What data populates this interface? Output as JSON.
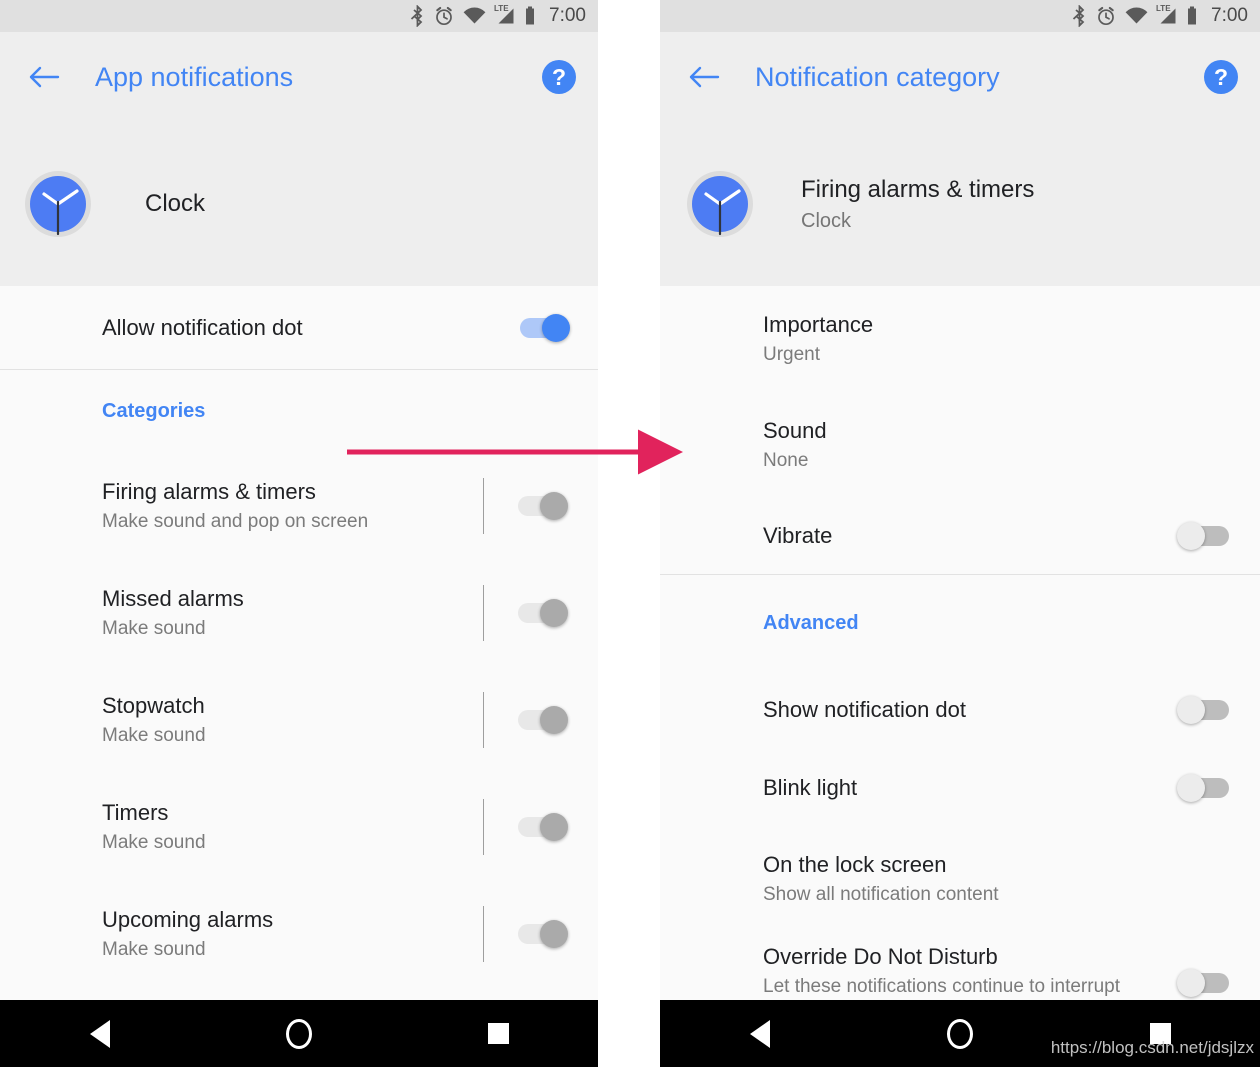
{
  "colors": {
    "accent_blue": "#4285f4",
    "arrow_pink": "#e1235c",
    "header_bg": "#eeeeee",
    "content_bg": "#fafafa",
    "statusbar_bg": "#e0e0e0",
    "toggle_on_grey": "#aaaaaa",
    "toggle_on_blue": "#4285f4",
    "toggle_off": "#ececec",
    "navbar_bg": "#000000"
  },
  "status_bar": {
    "time": "7:00",
    "icons": [
      "bluetooth-icon",
      "alarm-icon",
      "wifi-icon",
      "lte-signal-icon",
      "battery-icon"
    ],
    "lte_label": "LTE"
  },
  "left_panel": {
    "appbar": {
      "back_label": "←",
      "title": "App notifications",
      "help_label": "?"
    },
    "app_header": {
      "icon": "clock-app-icon",
      "name": "Clock"
    },
    "allow_dot": {
      "label": "Allow notification dot",
      "toggle_state": "on"
    },
    "section_label": "Categories",
    "categories": [
      {
        "title": "Firing alarms & timers",
        "subtitle": "Make sound and pop on screen",
        "toggle_state": "on"
      },
      {
        "title": "Missed alarms",
        "subtitle": "Make sound",
        "toggle_state": "on"
      },
      {
        "title": "Stopwatch",
        "subtitle": "Make sound",
        "toggle_state": "on"
      },
      {
        "title": "Timers",
        "subtitle": "Make sound",
        "toggle_state": "on"
      },
      {
        "title": "Upcoming alarms",
        "subtitle": "Make sound",
        "toggle_state": "on"
      }
    ]
  },
  "right_panel": {
    "appbar": {
      "back_label": "←",
      "title": "Notification category",
      "help_label": "?"
    },
    "app_header": {
      "icon": "clock-app-icon",
      "title": "Firing alarms & timers",
      "subtitle": "Clock"
    },
    "settings": [
      {
        "title": "Importance",
        "subtitle": "Urgent"
      },
      {
        "title": "Sound",
        "subtitle": "None"
      },
      {
        "title": "Vibrate",
        "subtitle": "",
        "toggle_state": "off"
      }
    ],
    "advanced_label": "Advanced",
    "advanced": [
      {
        "title": "Show notification dot",
        "subtitle": "",
        "toggle_state": "off"
      },
      {
        "title": "Blink light",
        "subtitle": "",
        "toggle_state": "off"
      },
      {
        "title": "On the lock screen",
        "subtitle": "Show all notification content"
      },
      {
        "title": "Override Do Not Disturb",
        "subtitle": "Let these notifications continue to interrupt when Do Not Disturb is set to",
        "toggle_state": "off"
      }
    ]
  },
  "nav_bar": {
    "back": "back-triangle-icon",
    "home": "home-circle-icon",
    "recents": "recents-square-icon"
  },
  "watermark": "https://blog.csdn.net/jdsjlzx",
  "annotation": {
    "type": "arrow",
    "description": "pink arrow pointing from Firing alarms & timers row to the Notification category screen"
  }
}
